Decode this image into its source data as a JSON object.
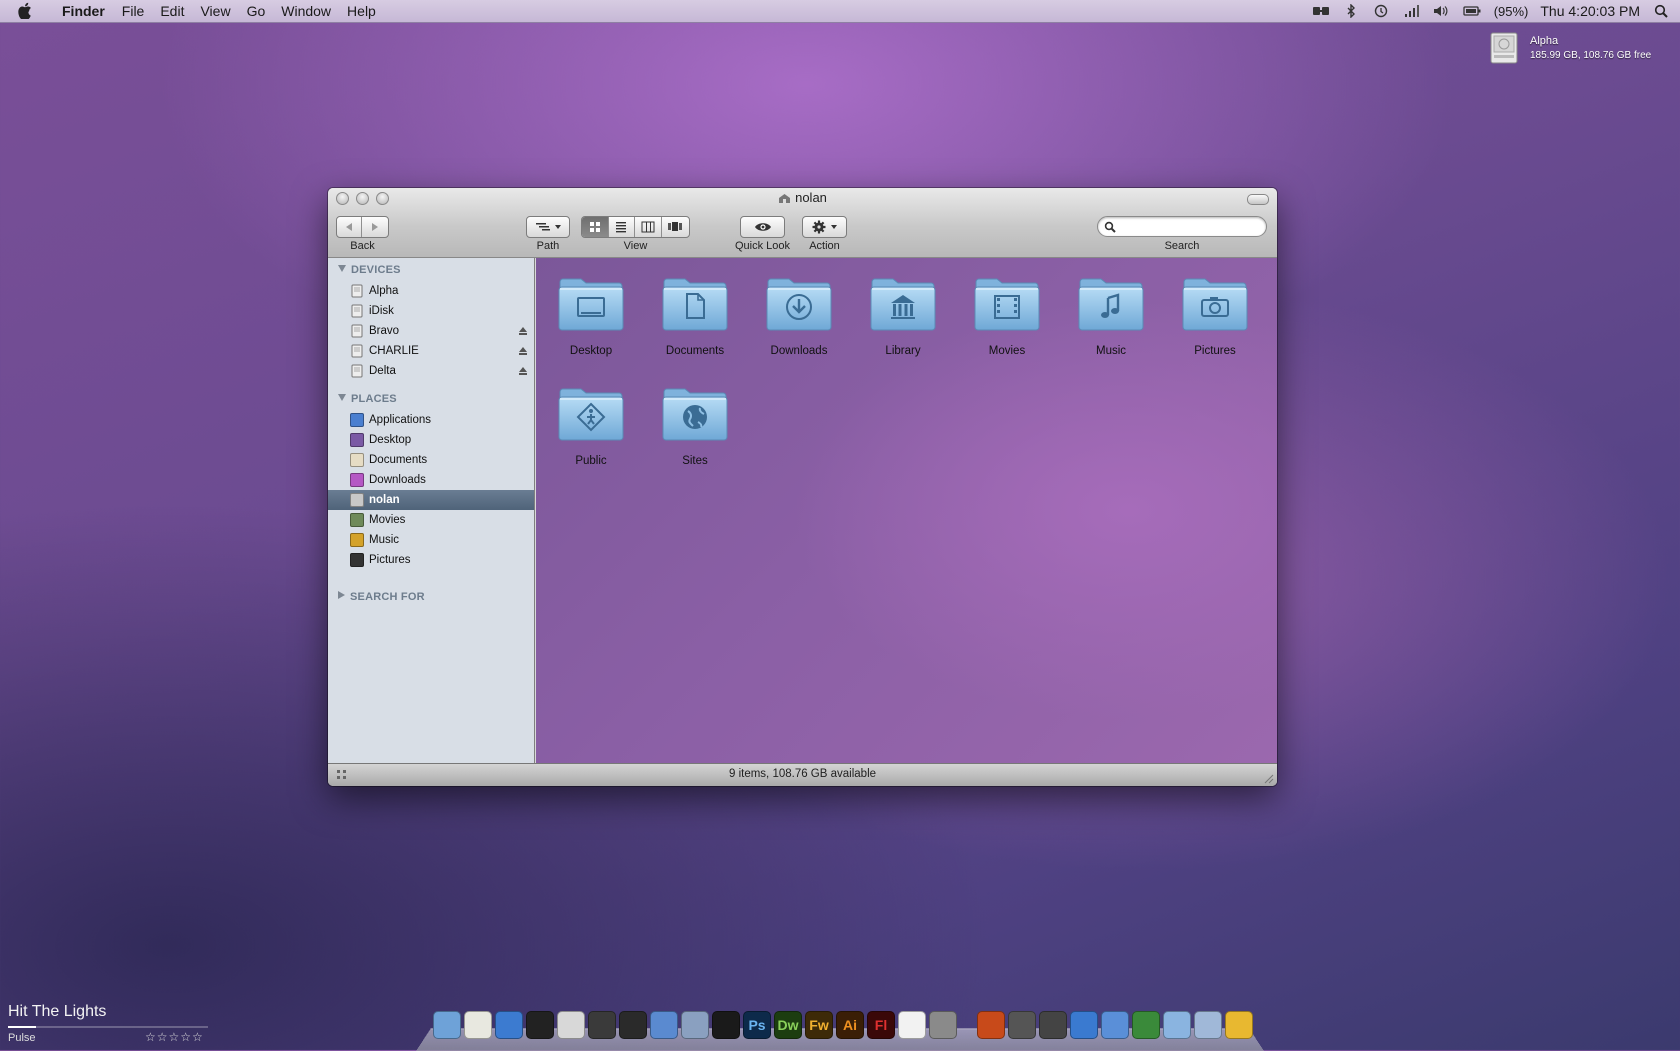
{
  "menubar": {
    "app_name": "Finder",
    "menus": [
      "File",
      "Edit",
      "View",
      "Go",
      "Window",
      "Help"
    ],
    "battery_percent": "(95%)",
    "clock": "Thu 4:20:03 PM",
    "status_icons": [
      "mirror-icon",
      "bluetooth-icon",
      "time-machine-icon",
      "wifi-icon",
      "volume-icon",
      "battery-icon",
      "spotlight-icon"
    ]
  },
  "desktop_drive": {
    "name": "Alpha",
    "info": "185.99 GB, 108.76 GB free"
  },
  "window": {
    "title": "nolan",
    "toolbar": {
      "back_label": "Back",
      "path_label": "Path",
      "view_label": "View",
      "quicklook_label": "Quick Look",
      "action_label": "Action",
      "search_label": "Search",
      "search_placeholder": "",
      "active_view": "icon"
    },
    "sidebar": {
      "devices_header": "DEVICES",
      "devices": [
        {
          "label": "Alpha",
          "eject": false
        },
        {
          "label": "iDisk",
          "eject": false
        },
        {
          "label": "Bravo",
          "eject": true
        },
        {
          "label": "CHARLIE",
          "eject": true
        },
        {
          "label": "Delta",
          "eject": true
        }
      ],
      "places_header": "PLACES",
      "places": [
        {
          "label": "Applications",
          "color": "#4a7fd0"
        },
        {
          "label": "Desktop",
          "color": "#7b5aa5"
        },
        {
          "label": "Documents",
          "color": "#e6dcc4"
        },
        {
          "label": "Downloads",
          "color": "#b557c4"
        },
        {
          "label": "nolan",
          "color": "#c8c8c8",
          "selected": true
        },
        {
          "label": "Movies",
          "color": "#6f8a5a"
        },
        {
          "label": "Music",
          "color": "#d4a22a"
        },
        {
          "label": "Pictures",
          "color": "#333333"
        }
      ],
      "search_header": "SEARCH FOR"
    },
    "items": [
      {
        "label": "Desktop",
        "emblem": "desktop"
      },
      {
        "label": "Documents",
        "emblem": "document"
      },
      {
        "label": "Downloads",
        "emblem": "download"
      },
      {
        "label": "Library",
        "emblem": "library"
      },
      {
        "label": "Movies",
        "emblem": "film"
      },
      {
        "label": "Music",
        "emblem": "note"
      },
      {
        "label": "Pictures",
        "emblem": "camera"
      },
      {
        "label": "Public",
        "emblem": "public"
      },
      {
        "label": "Sites",
        "emblem": "globe"
      }
    ],
    "status": "9 items, 108.76 GB available"
  },
  "dock": {
    "apps": [
      {
        "name": "finder-icon",
        "text": "",
        "bg": "#6ea2d8"
      },
      {
        "name": "preview-icon",
        "text": "",
        "bg": "#e8e8e0"
      },
      {
        "name": "safari-icon",
        "text": "",
        "bg": "#3c7bd0"
      },
      {
        "name": "adium-icon",
        "text": "",
        "bg": "#222222"
      },
      {
        "name": "pen-tool-icon",
        "text": "",
        "bg": "#d8d8d8"
      },
      {
        "name": "camera-icon",
        "text": "",
        "bg": "#3a3a3a"
      },
      {
        "name": "telescope-icon",
        "text": "",
        "bg": "#2a2a2a"
      },
      {
        "name": "grapher-icon",
        "text": "",
        "bg": "#5a8ad0"
      },
      {
        "name": "script-editor-icon",
        "text": "",
        "bg": "#8aa0c0"
      },
      {
        "name": "text-editor-icon",
        "text": "",
        "bg": "#1a1a1a"
      },
      {
        "name": "photoshop-icon",
        "text": "Ps",
        "bg": "#0d2a4a",
        "fg": "#6ab4f0"
      },
      {
        "name": "dreamweaver-icon",
        "text": "Dw",
        "bg": "#1c3d10",
        "fg": "#8ad05a"
      },
      {
        "name": "fireworks-icon",
        "text": "Fw",
        "bg": "#3d2a08",
        "fg": "#f0b030"
      },
      {
        "name": "illustrator-icon",
        "text": "Ai",
        "bg": "#3a1e06",
        "fg": "#f09020"
      },
      {
        "name": "flash-icon",
        "text": "Fl",
        "bg": "#3a0808",
        "fg": "#e03030"
      },
      {
        "name": "acrobat-icon",
        "text": "",
        "bg": "#f2f2f2"
      },
      {
        "name": "system-preferences-icon",
        "text": "",
        "bg": "#8a8a8a"
      },
      {
        "name": "gap",
        "text": "",
        "bg": ""
      },
      {
        "name": "apple-downloads-icon",
        "text": "",
        "bg": "#c84a1a"
      },
      {
        "name": "xcode-icon",
        "text": "",
        "bg": "#555555"
      },
      {
        "name": "screenshot-icon",
        "text": "",
        "bg": "#444444"
      },
      {
        "name": "app-store-icon",
        "text": "",
        "bg": "#3a7ad0"
      },
      {
        "name": "folder-stack-icon",
        "text": "",
        "bg": "#5a8fd8"
      },
      {
        "name": "money-icon",
        "text": "",
        "bg": "#3a8a3a"
      },
      {
        "name": "pictures-stack-icon",
        "text": "",
        "bg": "#8ab4e0"
      },
      {
        "name": "documents-stack-icon",
        "text": "",
        "bg": "#a0b8d8"
      },
      {
        "name": "notes-icon",
        "text": "",
        "bg": "#e8b830"
      }
    ]
  },
  "now_playing": {
    "song": "Hit The Lights",
    "artist": "Pulse",
    "rating": "☆☆☆☆☆",
    "progress": 0.14
  }
}
